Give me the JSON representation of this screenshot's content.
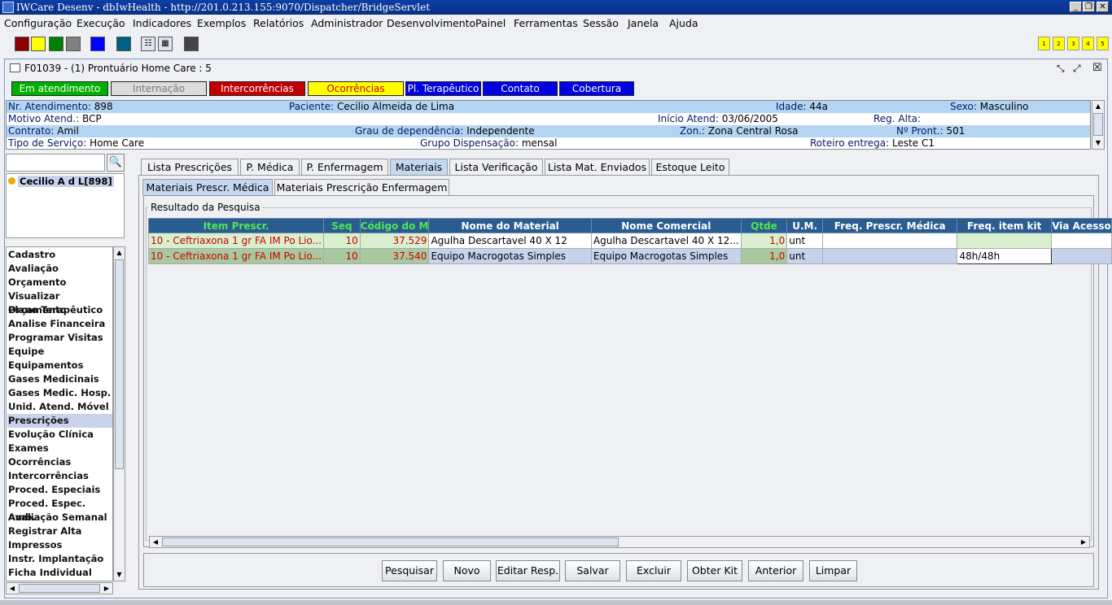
{
  "window": {
    "title": "IWCare Desenv - dbIwHealth - http://201.0.213.155:9070/Dispatcher/BridgeServlet"
  },
  "menu": [
    "Configuração",
    "Execução",
    "Indicadores",
    "Exemplos",
    "Relatórios",
    "Administrador",
    "Desenvolvimento",
    "Painel",
    "Ferramentas",
    "Sessão",
    "Janela",
    "Ajuda"
  ],
  "toolbar": {
    "color_swatches": [
      "#8b0000",
      "#ffff00",
      "#008000",
      "#808080",
      "#0000ff",
      "#006080"
    ],
    "numbered_buttons": [
      "1",
      "2",
      "3",
      "4",
      "5"
    ]
  },
  "frame": {
    "title": "F01039 - (1) Prontuário Home Care : 5"
  },
  "status_buttons": [
    {
      "label": "Em atendimento",
      "bg": "#00b000",
      "fg": "#ffffff"
    },
    {
      "label": "Internação",
      "bg": "#dcdcdc",
      "fg": "#7a7a7a"
    },
    {
      "label": "Intercorrências",
      "bg": "#c00000",
      "fg": "#ffffff"
    },
    {
      "label": "Ocorrências",
      "bg": "#ffff00",
      "fg": "#cc0000"
    },
    {
      "label": "Pl. Terapêutico",
      "bg": "#0000e0",
      "fg": "#ffffff"
    },
    {
      "label": "Contato",
      "bg": "#0000e0",
      "fg": "#ffffff"
    },
    {
      "label": "Cobertura",
      "bg": "#0000e0",
      "fg": "#ffffff"
    }
  ],
  "patient": {
    "nr_atendimento": {
      "label": "Nr. Atendimento:",
      "value": "898"
    },
    "paciente": {
      "label": "Paciente:",
      "value": "Cecilio Almeida de Lima"
    },
    "idade": {
      "label": "Idade:",
      "value": "44a"
    },
    "sexo": {
      "label": "Sexo:",
      "value": "Masculino"
    },
    "motivo": {
      "label": "Motivo Atend.:",
      "value": "BCP"
    },
    "inicio": {
      "label": "Início Atend:",
      "value": "03/06/2005"
    },
    "reg_alta": {
      "label": "Reg. Alta:",
      "value": ""
    },
    "contrato": {
      "label": "Contrato:",
      "value": "Amil"
    },
    "grau": {
      "label": "Grau de dependência:",
      "value": "Independente"
    },
    "zona": {
      "label": "Zon.:",
      "value": "Zona Central Rosa"
    },
    "pront": {
      "label": "Nº Pront.:",
      "value": "501"
    },
    "tipo_servico": {
      "label": "Tipo de Serviço:",
      "value": "Home Care"
    },
    "grupo": {
      "label": "Grupo Dispensação:",
      "value": "mensal"
    },
    "roteiro": {
      "label": "Roteiro entrega:",
      "value": "Leste C1"
    }
  },
  "search": {
    "value": ""
  },
  "tree": {
    "items": [
      "Cecilio A d L[898]"
    ]
  },
  "nav": {
    "items": [
      "Cadastro",
      "Avaliação",
      "Orçamento",
      "Visualizar Orçamento",
      "Plano Terapêutico",
      "Analise Financeira",
      "Programar Visitas",
      "Equipe",
      "Equipamentos",
      "Gases Medicinais",
      "Gases Medic. Hosp.",
      "Unid. Atend. Móvel",
      "Prescrições",
      "Evolução Clínica",
      "Exames",
      "Ocorrências",
      "Intercorrências",
      "Proced. Especiais",
      "Proced. Espec. Amb.",
      "Avaliação Semanal",
      "Registrar Alta",
      "Impressos",
      "Instr. Implantação",
      "Ficha Individual"
    ],
    "selected": "Prescrições"
  },
  "tabs": [
    "Lista Prescrições",
    "P. Médica",
    "P. Enfermagem",
    "Materiais",
    "Lista Verificação",
    "Lista Mat. Enviados",
    "Estoque Leito"
  ],
  "subtabs": [
    "Materiais Prescr. Médica",
    "Materiais Prescrição Enfermagem"
  ],
  "group_title": "Resultado da Pesquisa",
  "table": {
    "columns": [
      "Item Prescr.",
      "Seq",
      "Código do M",
      "Nome do Material",
      "Nome Comercial",
      "Qtde",
      "U.M.",
      "Freq. Prescr. Médica",
      "Freq. item kit",
      "Via Acesso"
    ],
    "rows": [
      [
        "10 - Ceftriaxona    1 gr  FA  IM Po Lio...",
        "10",
        "37.529",
        "Agulha Descartavel 40 X 12",
        "Agulha Descartavel 40 X 12...",
        "1,0",
        "unt",
        "",
        "",
        ""
      ],
      [
        "10 - Ceftriaxona    1 gr  FA  IM Po Lio...",
        "10",
        "37.540",
        "Equipo Macrogotas Simples",
        "Equipo Macrogotas Simples",
        "1,0",
        "unt",
        "",
        "48h/48h",
        ""
      ]
    ]
  },
  "buttons": [
    "Pesquisar",
    "Novo",
    "Editar Resp.",
    "Salvar",
    "Excluir",
    "Obter Kit",
    "Anterior",
    "Limpar"
  ]
}
